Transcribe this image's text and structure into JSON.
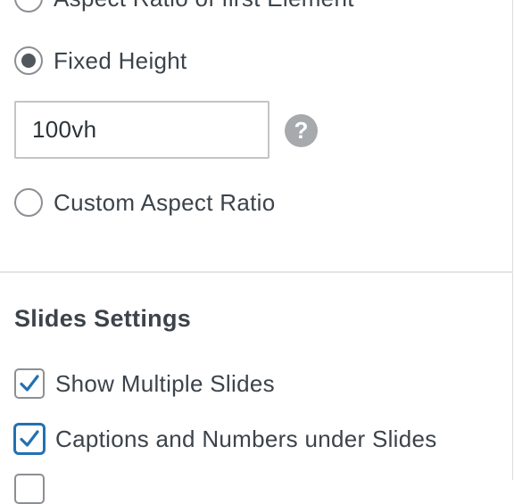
{
  "aspect": {
    "options": [
      {
        "label": "Aspect Ratio of first Element",
        "selected": false
      },
      {
        "label": "Fixed Height",
        "selected": true
      },
      {
        "label": "Custom Aspect Ratio",
        "selected": false
      }
    ],
    "height_value": "100vh",
    "help_symbol": "?"
  },
  "slides": {
    "title": "Slides Settings",
    "checkboxes": [
      {
        "label": "Show Multiple Slides",
        "checked": true
      },
      {
        "label": "Captions and Numbers under Slides",
        "checked": true
      },
      {
        "label": "",
        "checked": false
      }
    ]
  },
  "colors": {
    "focus_accent": "#2271b1",
    "help_icon_bg": "#a7aaad",
    "text": "#3c434a"
  }
}
